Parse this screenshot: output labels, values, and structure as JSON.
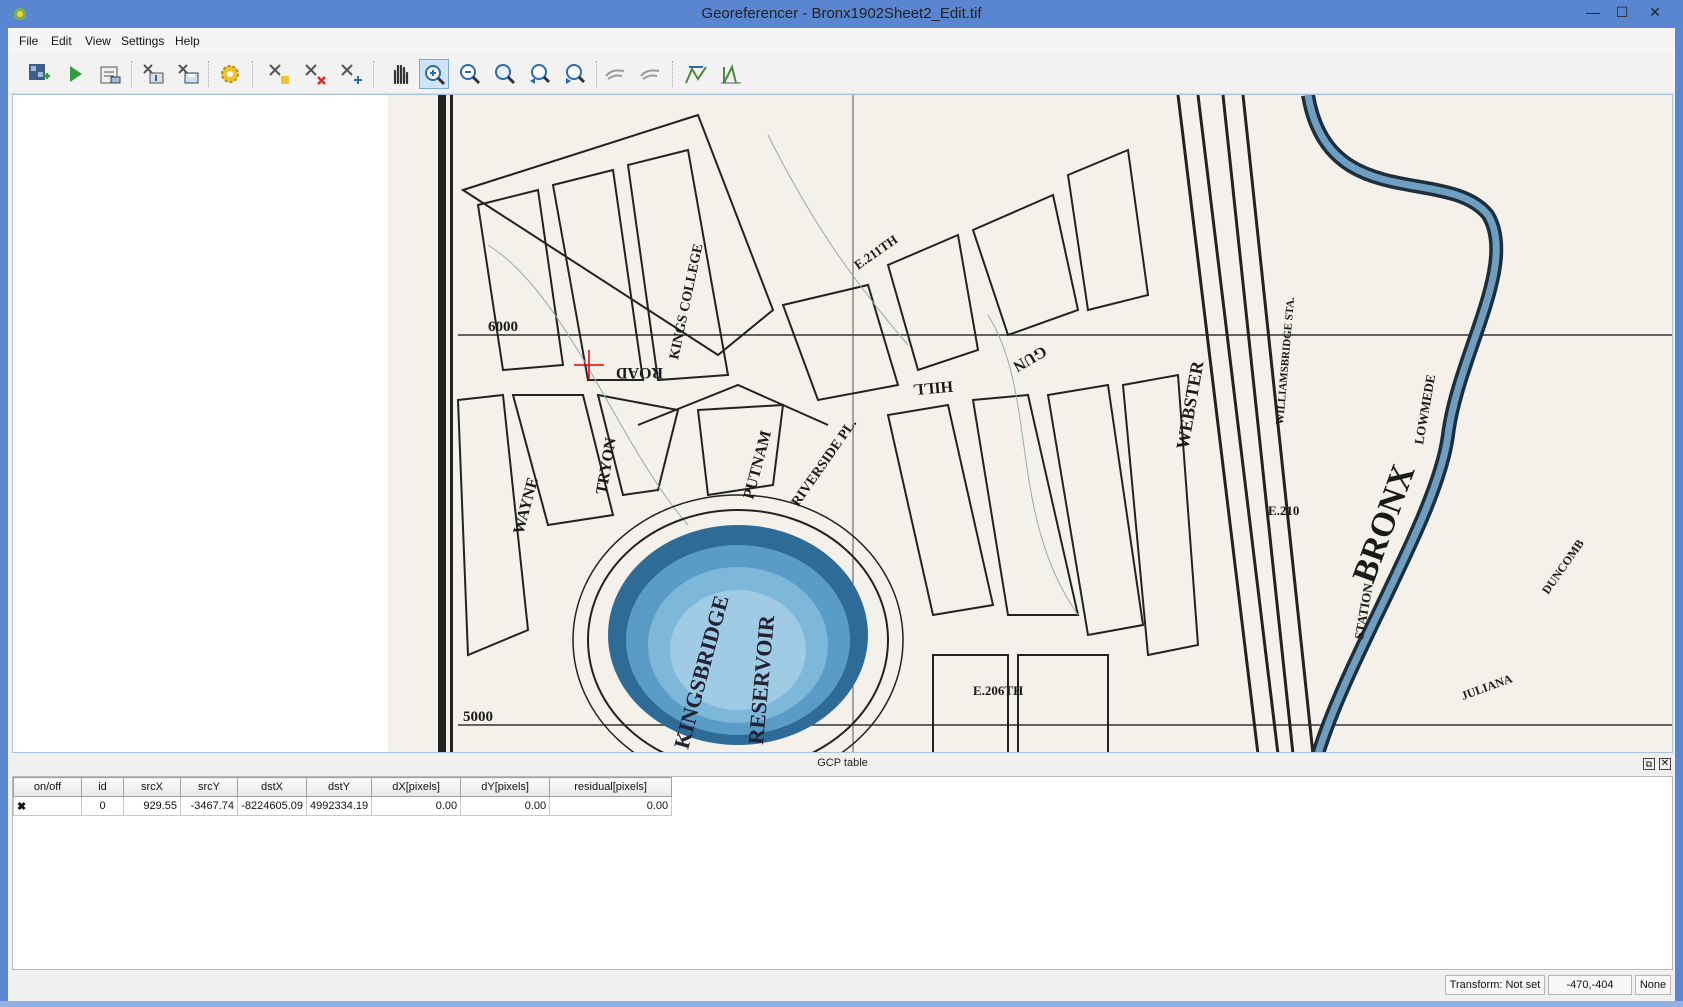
{
  "window": {
    "title": "Georeferencer - Bronx1902Sheet2_Edit.tif",
    "minimize": "—",
    "maximize": "☐",
    "close": "✕"
  },
  "menu": [
    "File",
    "Edit",
    "View",
    "Settings",
    "Help"
  ],
  "toolbar": [
    {
      "name": "open-raster-icon"
    },
    {
      "name": "start-georeferencing-icon"
    },
    {
      "name": "generate-gdal-script-icon"
    },
    {
      "name": "load-gcp-points-icon"
    },
    {
      "name": "save-gcp-points-icon"
    },
    {
      "name": "transformation-settings-icon"
    },
    {
      "name": "add-point-icon"
    },
    {
      "name": "delete-point-icon"
    },
    {
      "name": "move-gcp-point-icon"
    },
    {
      "name": "pan-icon"
    },
    {
      "name": "zoom-in-icon"
    },
    {
      "name": "zoom-out-icon"
    },
    {
      "name": "zoom-to-layer-icon"
    },
    {
      "name": "zoom-last-icon"
    },
    {
      "name": "zoom-next-icon"
    },
    {
      "name": "link-georeferencer-to-qgis-icon"
    },
    {
      "name": "link-qgis-to-georeferencer-icon"
    },
    {
      "name": "full-histogram-stretch-icon"
    },
    {
      "name": "local-histogram-stretch-icon"
    }
  ],
  "map_labels": {
    "road": "ROAD",
    "hill": "HILL",
    "gun": "GUN",
    "tryon": "TRYON",
    "wayne": "WAYNE",
    "putnam": "PUTNAM",
    "riverside": "RIVERSIDE PL.",
    "kings_college": "KINGS COLLEGE",
    "webster": "WEBSTER",
    "bronx": "BRONX",
    "e211": "E.211TH",
    "e210": "E.210",
    "e206": "E.206TH",
    "grid6000": "6000",
    "grid5000": "5000",
    "station": "STATION",
    "lowmede": "LOWMEDE",
    "juliana": "JULIANA",
    "duncomb": "DUNCOMB",
    "kingsbridge": "KINGSBRIDGE",
    "reservoir": "RESERVOIR",
    "williamsbridge": "WILLIAMSBRIDGE STA."
  },
  "gcp_table": {
    "title": "GCP table",
    "columns": [
      "on/off",
      "id",
      "srcX",
      "srcY",
      "dstX",
      "dstY",
      "dX[pixels]",
      "dY[pixels]",
      "residual[pixels]"
    ],
    "rows": [
      {
        "onoff": "✖",
        "id": "0",
        "srcX": "929.55",
        "srcY": "-3467.74",
        "dstX": "-8224605.09",
        "dstY": "4992334.19",
        "dX": "0.00",
        "dY": "0.00",
        "residual": "0.00"
      }
    ]
  },
  "status": {
    "transform": "Transform: Not set",
    "coords": "-470,-404",
    "crs": "None"
  }
}
